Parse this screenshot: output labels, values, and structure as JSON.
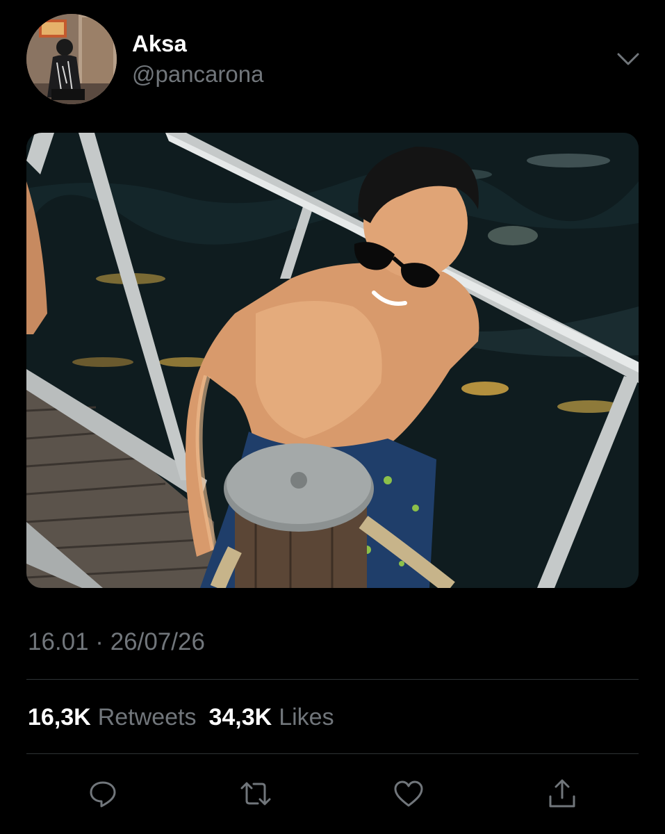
{
  "user": {
    "display_name": "Aksa",
    "handle": "@pancarona",
    "avatar_icon": "profile-photo"
  },
  "menu_icon": "chevron-down-icon",
  "media": {
    "type": "photo",
    "rounded": true
  },
  "meta": {
    "timestamp": "16.01 · 26/07/26"
  },
  "stats": {
    "retweets_count": "16,3K",
    "retweets_label": "Retweets",
    "likes_count": "34,3K",
    "likes_label": "Likes"
  },
  "actions": [
    {
      "icon": "reply-icon"
    },
    {
      "icon": "retweet-icon"
    },
    {
      "icon": "like-icon"
    },
    {
      "icon": "share-icon"
    }
  ],
  "colors": {
    "background": "#000000",
    "primary_text": "#ffffff",
    "secondary_text": "#71767b",
    "divider": "#2f3336"
  }
}
